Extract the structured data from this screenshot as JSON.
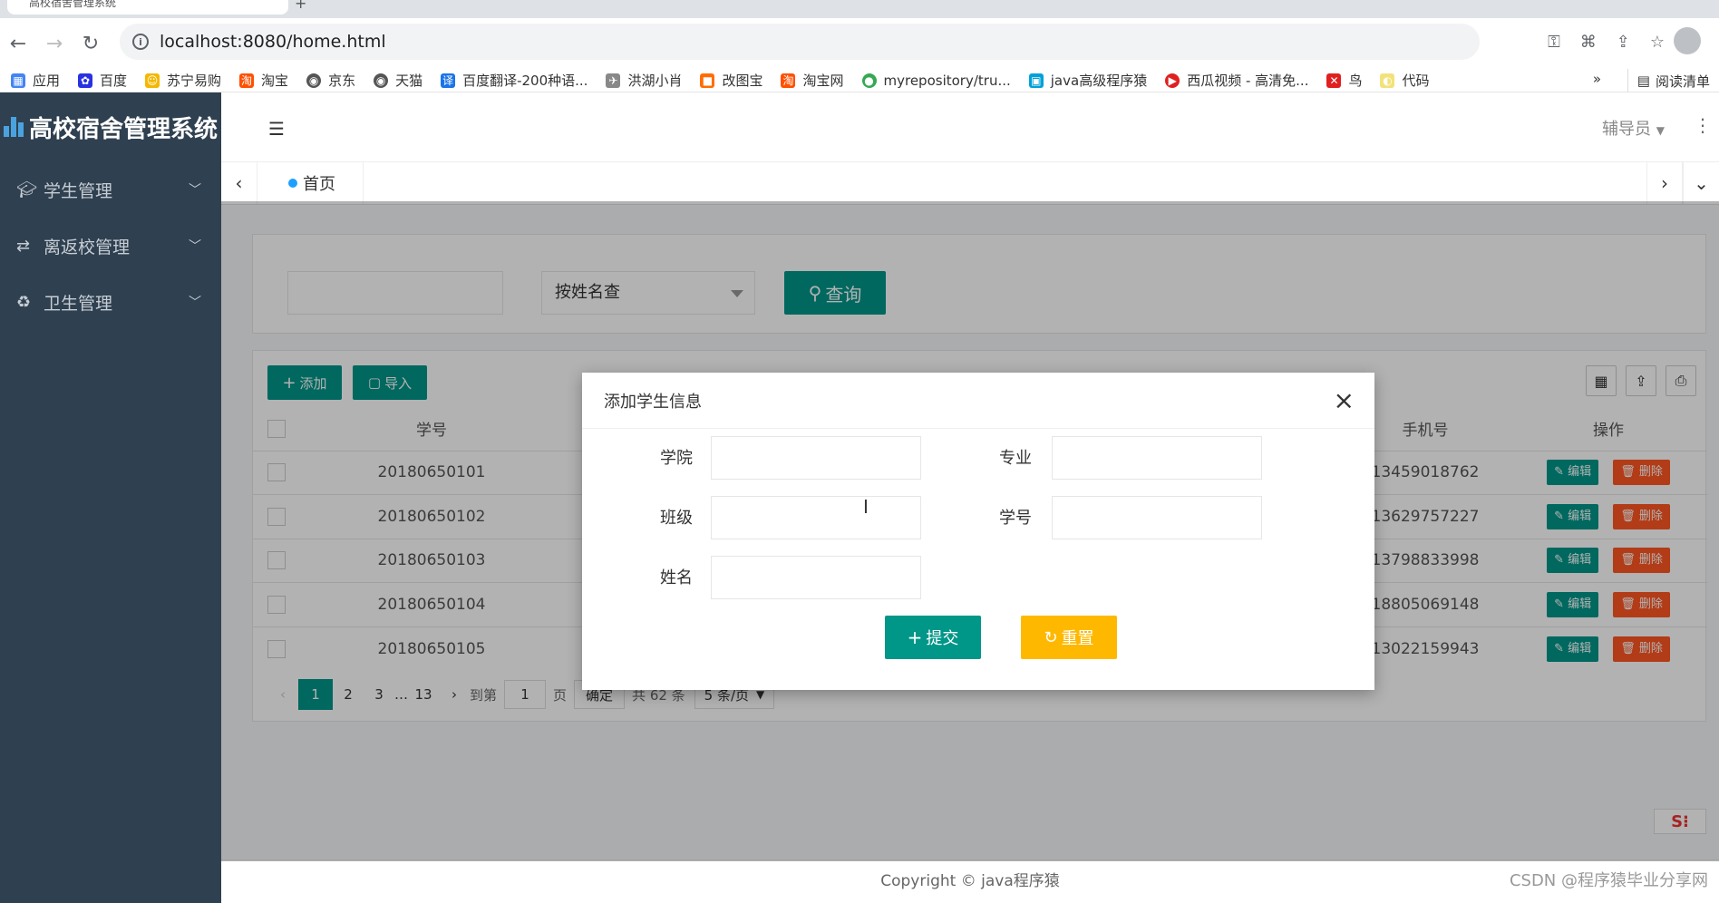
{
  "browser": {
    "tab_title": "高校宿舍管理系统",
    "url": "localhost:8080/home.html",
    "bookmarks": [
      "应用",
      "百度",
      "苏宁易购",
      "淘宝",
      "京东",
      "天猫",
      "百度翻译-200种语...",
      "洪湖小肖",
      "改图宝",
      "淘宝网",
      "myrepository/tru...",
      "java高级程序猿",
      "西瓜视频 - 高清免...",
      "鸟",
      "代码"
    ],
    "bookmarks_more": "»",
    "reading_list": "阅读清单"
  },
  "app": {
    "logo_text": "高校宿舍管理系统",
    "sidebar": [
      {
        "label": "学生管理",
        "icon": "graduation-cap-icon"
      },
      {
        "label": "离返校管理",
        "icon": "exchange-icon"
      },
      {
        "label": "卫生管理",
        "icon": "recycle-icon"
      }
    ],
    "role": "辅导员",
    "tab_home": "首页"
  },
  "search": {
    "input_value": "",
    "select_value": "按姓名查",
    "query_button": "查询"
  },
  "toolbar": {
    "add_label": "添加",
    "import_label": "导入"
  },
  "table": {
    "headers": [
      "学号",
      "手机号",
      "操作"
    ],
    "rows": [
      {
        "id": "20180650101",
        "phone": "13459018762"
      },
      {
        "id": "20180650102",
        "phone": "13629757227"
      },
      {
        "id": "20180650103",
        "phone": "13798833998"
      },
      {
        "id": "20180650104",
        "phone": "18805069148"
      },
      {
        "id": "20180650105",
        "phone": "13022159943"
      }
    ],
    "edit_label": "编辑",
    "delete_label": "删除"
  },
  "pager": {
    "pages": [
      "1",
      "2",
      "3",
      "…",
      "13"
    ],
    "current": "1",
    "goto_label": "到第",
    "goto_value": "1",
    "page_unit": "页",
    "confirm_label": "确定",
    "total_label": "共 62 条",
    "per_page": "5 条/页"
  },
  "modal": {
    "title": "添加学生信息",
    "fields": {
      "college": "学院",
      "major": "专业",
      "class": "班级",
      "student_no": "学号",
      "name": "姓名"
    },
    "submit_label": "提交",
    "reset_label": "重置"
  },
  "footer": {
    "copyright": "Copyright © java程序猿",
    "watermark": "CSDN @程序猿毕业分享网"
  }
}
